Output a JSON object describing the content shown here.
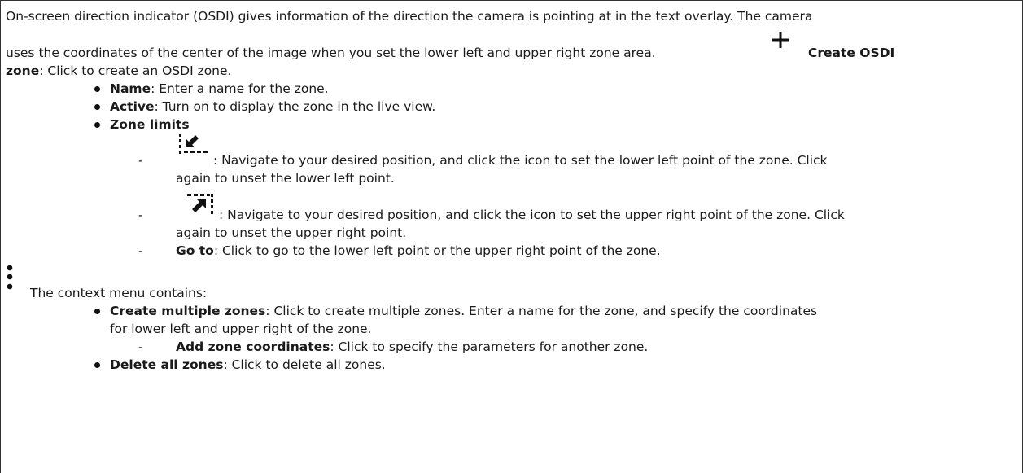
{
  "intro": {
    "line1": "On-screen direction indicator (OSDI) gives information of the direction the camera is pointing at in the text overlay. The camera",
    "line2": "uses the coordinates of the center of the image when you set the lower left and upper right zone area.",
    "create_label": "Create OSDI",
    "create_label_2": "zone",
    "create_desc": ": Click to create an OSDI zone."
  },
  "create_items": [
    {
      "label": "Name",
      "desc": ": Enter a name for the zone."
    },
    {
      "label": "Active",
      "desc": ": Turn on to display the zone in the live view."
    },
    {
      "label": "Zone limits",
      "desc": ""
    }
  ],
  "zone_limits": {
    "lower_left_line1": ": Navigate to your desired position, and click the icon to set the lower left point of the zone. Click",
    "lower_left_line2": "again to unset the lower left point.",
    "upper_right_line1": ": Navigate to your desired position, and click the icon to set the upper right point of the zone. Click",
    "upper_right_line2": "again to unset the upper right point.",
    "goto_label": "Go to",
    "goto_desc": ": Click to go to the lower left point or the upper right point of the zone."
  },
  "context": {
    "intro": "The context menu contains:",
    "item1_label": "Create multiple zones",
    "item1_desc": ": Click to create multiple zones. Enter a name for the zone, and specify the coordinates",
    "item1_desc2": "for lower left and upper right of the zone.",
    "sub_label": "Add zone coordinates",
    "sub_desc": ": Click to specify the parameters for another zone.",
    "item2_label": "Delete all zones",
    "item2_desc": ": Click to delete all zones."
  },
  "icons": [
    "plus-icon",
    "lower-left-corner-icon",
    "upper-right-corner-icon",
    "more-vertical-icon"
  ]
}
